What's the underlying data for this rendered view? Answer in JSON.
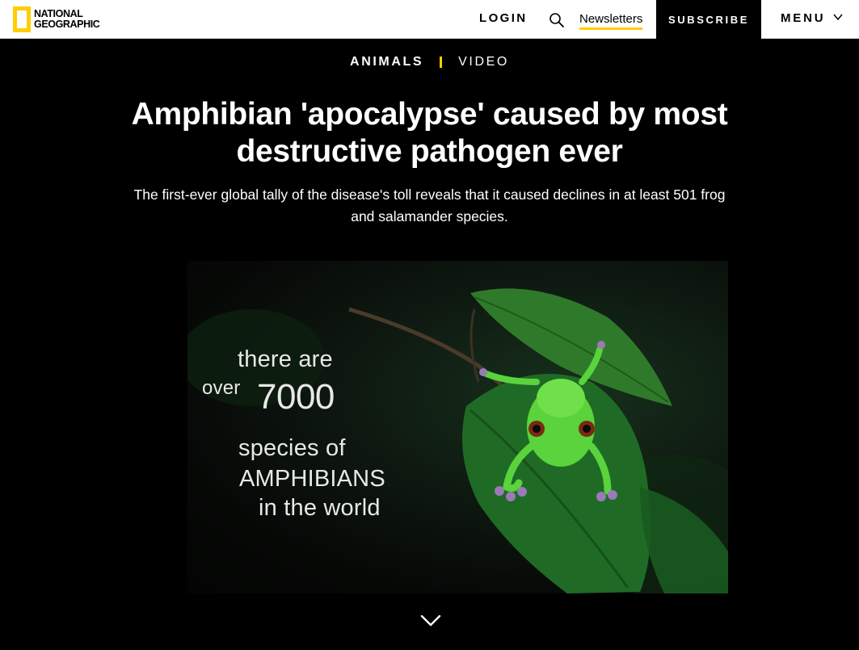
{
  "header": {
    "logo_line1": "National",
    "logo_line2": "Geographic",
    "login_label": "LOGIN",
    "search_icon": "search-icon",
    "newsletters_label": "Newsletters",
    "subscribe_label": "SUBSCRIBE",
    "menu_label": "MENU",
    "menu_icon": "chevron-down-icon"
  },
  "article": {
    "section": "ANIMALS",
    "type": "VIDEO",
    "headline": "Amphibian 'apocalypse' caused by most destructive pathogen ever",
    "dek": "The first-ever global tally of the disease's toll reveals that it caused declines in at least 501 frog and salamander species."
  },
  "video": {
    "line1": "there are",
    "line2a": "over",
    "line2b": "7000",
    "line3": "species of",
    "line4": "AMPHIBIANS",
    "line5": "in the world"
  },
  "scroll_icon": "chevron-down-icon",
  "colors": {
    "accent_yellow": "#ffce00",
    "background": "#000000",
    "frog_green": "#5ad33c"
  }
}
